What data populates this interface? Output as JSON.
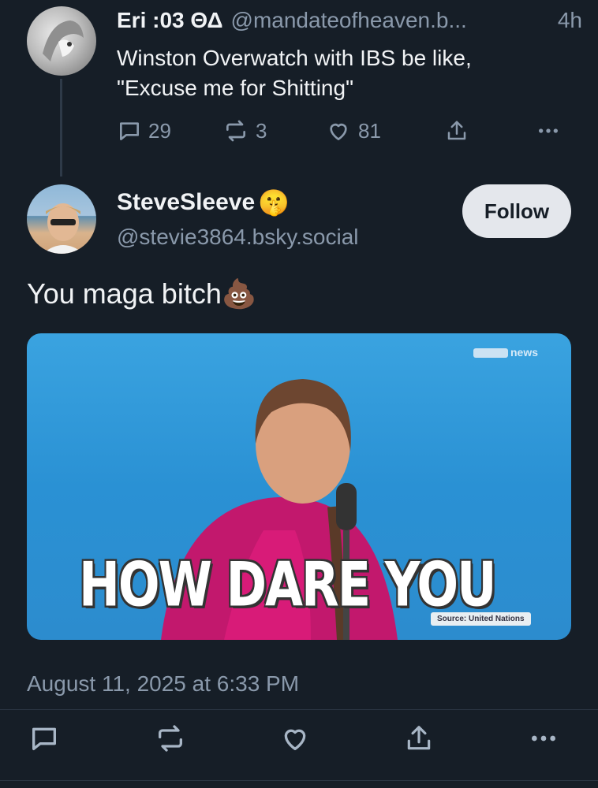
{
  "parent_post": {
    "display_name": "Eri :03 ΘΔ",
    "handle": "@mandateofheaven.b...",
    "time": "4h",
    "text": "Winston Overwatch with IBS be like,\n\"Excuse me for Shitting\"",
    "replies": "29",
    "reposts": "3",
    "likes": "81"
  },
  "main_post": {
    "display_name": "SteveSleeve",
    "name_emoji": "🤫",
    "handle": "@stevie3864.bsky.social",
    "follow_label": "Follow",
    "text": "You maga bitch",
    "text_emoji": "💩",
    "media": {
      "caption": "HOW DARE YOU",
      "watermark": "news",
      "source": "Source: United Nations"
    },
    "date": "August 11, 2025 at 6:33 PM"
  },
  "colors": {
    "background": "#161e27",
    "muted": "#8a99ab",
    "text": "#f1f3f5",
    "follow_bg": "#e4e7ec"
  },
  "icons": {
    "reply": "reply-icon",
    "repost": "repost-icon",
    "like": "heart-icon",
    "share": "share-icon",
    "more": "more-icon"
  }
}
